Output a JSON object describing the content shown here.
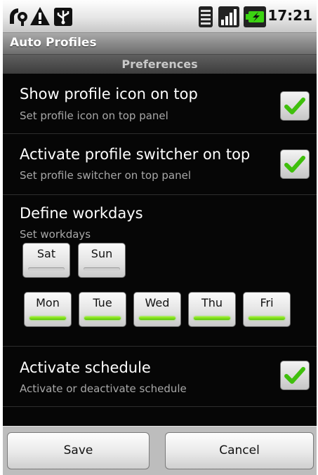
{
  "status_bar": {
    "time": "17:21",
    "icons": [
      "wifi-scan-icon",
      "warning-icon",
      "usb-icon",
      "wifi-signal-icon",
      "cell-signal-icon",
      "battery-charging-icon"
    ]
  },
  "app": {
    "title": "Auto Profiles"
  },
  "preferences": {
    "category": "Preferences",
    "show_icon": {
      "title": "Show profile icon on top",
      "summary": "Set profile icon on top panel",
      "checked": true
    },
    "profile_switcher": {
      "title": "Activate profile switcher on top",
      "summary": "Set profile switcher on top panel",
      "checked": true
    },
    "workdays": {
      "title": "Define workdays",
      "summary": "Set workdays",
      "days": [
        {
          "label": "Sat",
          "on": false
        },
        {
          "label": "Sun",
          "on": false
        },
        {
          "label": "Mon",
          "on": true
        },
        {
          "label": "Tue",
          "on": true
        },
        {
          "label": "Wed",
          "on": true
        },
        {
          "label": "Thu",
          "on": true
        },
        {
          "label": "Fri",
          "on": true
        }
      ]
    },
    "schedule": {
      "title": "Activate schedule",
      "summary": "Activate or deactivate schedule",
      "checked": true
    }
  },
  "buttons": {
    "save": "Save",
    "cancel": "Cancel"
  },
  "colors": {
    "check_green": "#3fbf0c",
    "toggle_on": "#6ee21c"
  }
}
